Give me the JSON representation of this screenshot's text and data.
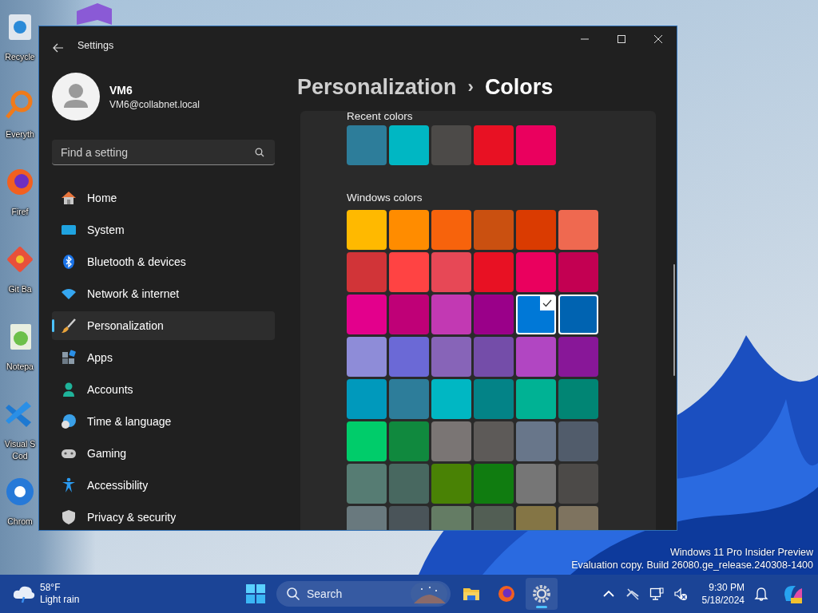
{
  "desktop": {
    "icons": [
      {
        "lines": [
          "Recycle"
        ]
      },
      {
        "lines": [
          "Everyth"
        ]
      },
      {
        "lines": [
          "Firef"
        ]
      },
      {
        "lines": [
          "Git Ba"
        ]
      },
      {
        "lines": [
          "Notepa"
        ]
      },
      {
        "lines": [
          "Visual S",
          "Cod"
        ]
      },
      {
        "lines": [
          "Chrom"
        ]
      }
    ],
    "watermark": {
      "line_1": "Windows 11 Pro Insider Preview",
      "line_2": "Evaluation copy. Build 26080.ge_release.240308-1400"
    }
  },
  "window": {
    "title": "Settings",
    "profile": {
      "name": "VM6",
      "email": "VM6@collabnet.local"
    },
    "search": {
      "placeholder": "Find a setting"
    },
    "nav": [
      {
        "label": "Home",
        "selected": false
      },
      {
        "label": "System",
        "selected": false
      },
      {
        "label": "Bluetooth & devices",
        "selected": false
      },
      {
        "label": "Network & internet",
        "selected": false
      },
      {
        "label": "Personalization",
        "selected": true
      },
      {
        "label": "Apps",
        "selected": false
      },
      {
        "label": "Accounts",
        "selected": false
      },
      {
        "label": "Time & language",
        "selected": false
      },
      {
        "label": "Gaming",
        "selected": false
      },
      {
        "label": "Accessibility",
        "selected": false
      },
      {
        "label": "Privacy & security",
        "selected": false
      }
    ],
    "breadcrumb": {
      "parent": "Personalization",
      "separator": "›",
      "current": "Colors"
    },
    "recent_colors": {
      "heading": "Recent colors",
      "swatches": [
        {
          "color": "#2d7d9a"
        },
        {
          "color": "#00b7c3"
        },
        {
          "color": "#4c4a48"
        },
        {
          "color": "#e81123"
        },
        {
          "color": "#ea005e"
        }
      ]
    },
    "windows_colors": {
      "heading": "Windows colors",
      "swatches": [
        {
          "color": "#ffb900",
          "selected": false,
          "hovered": false
        },
        {
          "color": "#ff8c00",
          "selected": false,
          "hovered": false
        },
        {
          "color": "#f7630c",
          "selected": false,
          "hovered": false
        },
        {
          "color": "#ca5010",
          "selected": false,
          "hovered": false
        },
        {
          "color": "#da3b01",
          "selected": false,
          "hovered": false
        },
        {
          "color": "#ef6950",
          "selected": false,
          "hovered": false
        },
        {
          "color": "#d13438",
          "selected": false,
          "hovered": false
        },
        {
          "color": "#ff4343",
          "selected": false,
          "hovered": false
        },
        {
          "color": "#e74856",
          "selected": false,
          "hovered": false
        },
        {
          "color": "#e81123",
          "selected": false,
          "hovered": false
        },
        {
          "color": "#ea005e",
          "selected": false,
          "hovered": false
        },
        {
          "color": "#c30052",
          "selected": false,
          "hovered": false
        },
        {
          "color": "#e3008c",
          "selected": false,
          "hovered": false
        },
        {
          "color": "#bf0077",
          "selected": false,
          "hovered": false
        },
        {
          "color": "#c239b3",
          "selected": false,
          "hovered": false
        },
        {
          "color": "#9a0089",
          "selected": false,
          "hovered": false
        },
        {
          "color": "#0078d7",
          "selected": true,
          "hovered": false
        },
        {
          "color": "#0063b1",
          "selected": false,
          "hovered": true
        },
        {
          "color": "#8e8cd8",
          "selected": false,
          "hovered": false
        },
        {
          "color": "#6b69d6",
          "selected": false,
          "hovered": false
        },
        {
          "color": "#8764b8",
          "selected": false,
          "hovered": false
        },
        {
          "color": "#744da9",
          "selected": false,
          "hovered": false
        },
        {
          "color": "#b146c2",
          "selected": false,
          "hovered": false
        },
        {
          "color": "#881798",
          "selected": false,
          "hovered": false
        },
        {
          "color": "#0099bc",
          "selected": false,
          "hovered": false
        },
        {
          "color": "#2d7d9a",
          "selected": false,
          "hovered": false
        },
        {
          "color": "#00b7c3",
          "selected": false,
          "hovered": false
        },
        {
          "color": "#038387",
          "selected": false,
          "hovered": false
        },
        {
          "color": "#00b294",
          "selected": false,
          "hovered": false
        },
        {
          "color": "#018574",
          "selected": false,
          "hovered": false
        },
        {
          "color": "#00cc6a",
          "selected": false,
          "hovered": false
        },
        {
          "color": "#10893e",
          "selected": false,
          "hovered": false
        },
        {
          "color": "#7a7574",
          "selected": false,
          "hovered": false
        },
        {
          "color": "#5d5a58",
          "selected": false,
          "hovered": false
        },
        {
          "color": "#68768a",
          "selected": false,
          "hovered": false
        },
        {
          "color": "#515c6b",
          "selected": false,
          "hovered": false
        },
        {
          "color": "#567c73",
          "selected": false,
          "hovered": false
        },
        {
          "color": "#486860",
          "selected": false,
          "hovered": false
        },
        {
          "color": "#498205",
          "selected": false,
          "hovered": false
        },
        {
          "color": "#107c10",
          "selected": false,
          "hovered": false
        },
        {
          "color": "#767676",
          "selected": false,
          "hovered": false
        },
        {
          "color": "#4c4a48",
          "selected": false,
          "hovered": false
        },
        {
          "color": "#69797e",
          "selected": false,
          "hovered": false
        },
        {
          "color": "#4a5459",
          "selected": false,
          "hovered": false
        },
        {
          "color": "#647c64",
          "selected": false,
          "hovered": false
        },
        {
          "color": "#525e54",
          "selected": false,
          "hovered": false
        },
        {
          "color": "#847545",
          "selected": false,
          "hovered": false
        },
        {
          "color": "#7e735f",
          "selected": false,
          "hovered": false
        }
      ]
    }
  },
  "taskbar": {
    "weather": {
      "temperature": "58°F",
      "condition": "Light rain"
    },
    "search": {
      "label": "Search"
    },
    "pinned_apps": [
      {
        "active": false
      },
      {
        "active": false
      },
      {
        "active": true
      }
    ],
    "clock": {
      "time": "9:30 PM",
      "date": "5/18/2024"
    }
  }
}
